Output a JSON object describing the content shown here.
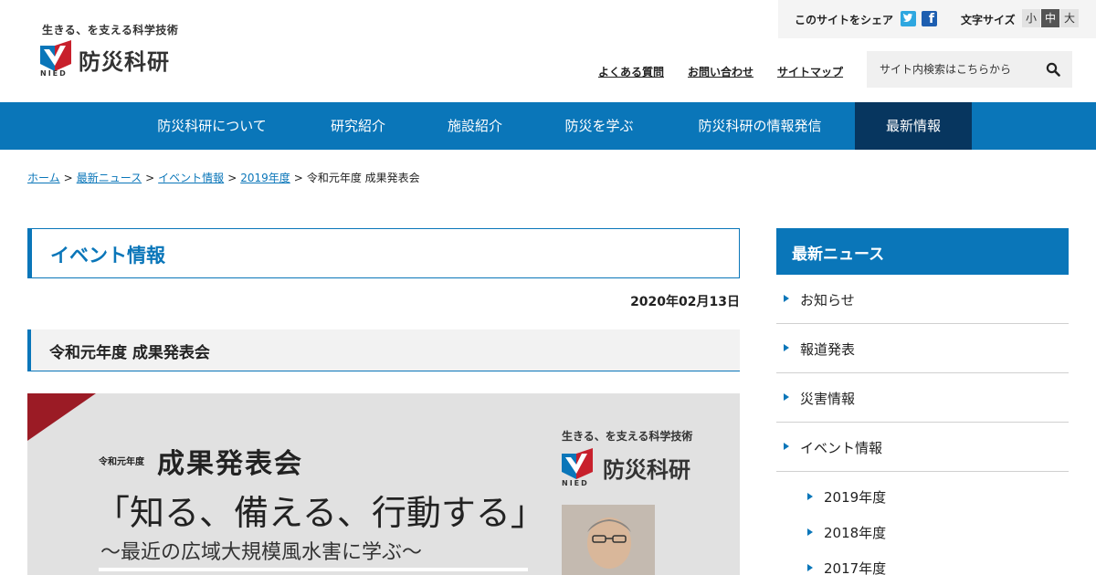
{
  "header": {
    "logo_tagline": "生きる、を支える科学技術",
    "logo_name": "防災科研",
    "logo_sub": "NIED",
    "share_label": "このサイトをシェア",
    "fb_glyph": "f",
    "font_size_label": "文字サイズ",
    "font_sizes": [
      "小",
      "中",
      "大"
    ],
    "font_size_selected": "中",
    "util_links": [
      "よくある質問",
      "お問い合わせ",
      "サイトマップ"
    ],
    "search_placeholder": "サイト内検索はこちらから"
  },
  "nav": {
    "items": [
      "防災科研について",
      "研究紹介",
      "施設紹介",
      "防災を学ぶ",
      "防災科研の情報発信",
      "最新情報"
    ],
    "active": "最新情報"
  },
  "breadcrumb": {
    "links": [
      "ホーム",
      "最新ニュース",
      "イベント情報",
      "2019年度"
    ],
    "current": "令和元年度 成果発表会",
    "separator": ">"
  },
  "main": {
    "page_title": "イベント情報",
    "date": "2020年02月13日",
    "article_title": "令和元年度 成果発表会"
  },
  "poster": {
    "year": "令和元年度",
    "event": "成果発表会",
    "theme": "「知る、備える、行動する」",
    "subtitle": "〜最近の広域大規模風水害に学ぶ〜",
    "logo_tagline": "生きる、を支える科学技術",
    "logo_name": "防災科研",
    "logo_sub": "NIED"
  },
  "sidebar": {
    "heading": "最新ニュース",
    "items": [
      "お知らせ",
      "報道発表",
      "災害情報",
      "イベント情報"
    ],
    "sub_items": [
      "2019年度",
      "2018年度",
      "2017年度"
    ]
  },
  "colors": {
    "brand_blue": "#0a76b9",
    "nav_active": "#07365f",
    "poster_red": "#9b1b25"
  }
}
